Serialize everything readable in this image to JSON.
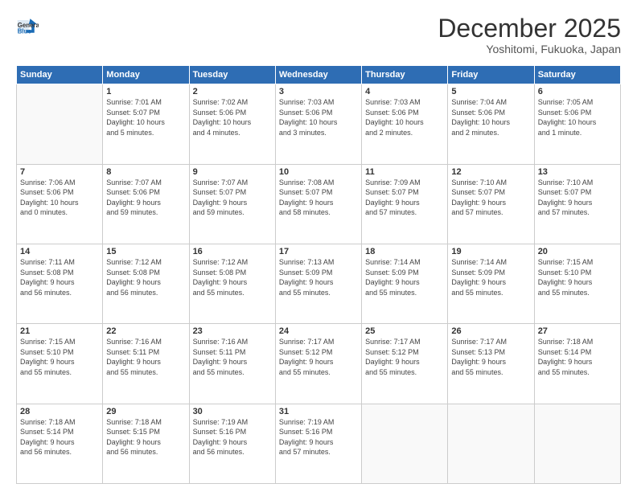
{
  "logo": {
    "line1": "General",
    "line2": "Blue"
  },
  "header": {
    "month": "December 2025",
    "location": "Yoshitomi, Fukuoka, Japan"
  },
  "weekdays": [
    "Sunday",
    "Monday",
    "Tuesday",
    "Wednesday",
    "Thursday",
    "Friday",
    "Saturday"
  ],
  "weeks": [
    [
      {
        "day": "",
        "info": ""
      },
      {
        "day": "1",
        "info": "Sunrise: 7:01 AM\nSunset: 5:07 PM\nDaylight: 10 hours\nand 5 minutes."
      },
      {
        "day": "2",
        "info": "Sunrise: 7:02 AM\nSunset: 5:06 PM\nDaylight: 10 hours\nand 4 minutes."
      },
      {
        "day": "3",
        "info": "Sunrise: 7:03 AM\nSunset: 5:06 PM\nDaylight: 10 hours\nand 3 minutes."
      },
      {
        "day": "4",
        "info": "Sunrise: 7:03 AM\nSunset: 5:06 PM\nDaylight: 10 hours\nand 2 minutes."
      },
      {
        "day": "5",
        "info": "Sunrise: 7:04 AM\nSunset: 5:06 PM\nDaylight: 10 hours\nand 2 minutes."
      },
      {
        "day": "6",
        "info": "Sunrise: 7:05 AM\nSunset: 5:06 PM\nDaylight: 10 hours\nand 1 minute."
      }
    ],
    [
      {
        "day": "7",
        "info": "Sunrise: 7:06 AM\nSunset: 5:06 PM\nDaylight: 10 hours\nand 0 minutes."
      },
      {
        "day": "8",
        "info": "Sunrise: 7:07 AM\nSunset: 5:06 PM\nDaylight: 9 hours\nand 59 minutes."
      },
      {
        "day": "9",
        "info": "Sunrise: 7:07 AM\nSunset: 5:07 PM\nDaylight: 9 hours\nand 59 minutes."
      },
      {
        "day": "10",
        "info": "Sunrise: 7:08 AM\nSunset: 5:07 PM\nDaylight: 9 hours\nand 58 minutes."
      },
      {
        "day": "11",
        "info": "Sunrise: 7:09 AM\nSunset: 5:07 PM\nDaylight: 9 hours\nand 57 minutes."
      },
      {
        "day": "12",
        "info": "Sunrise: 7:10 AM\nSunset: 5:07 PM\nDaylight: 9 hours\nand 57 minutes."
      },
      {
        "day": "13",
        "info": "Sunrise: 7:10 AM\nSunset: 5:07 PM\nDaylight: 9 hours\nand 57 minutes."
      }
    ],
    [
      {
        "day": "14",
        "info": "Sunrise: 7:11 AM\nSunset: 5:08 PM\nDaylight: 9 hours\nand 56 minutes."
      },
      {
        "day": "15",
        "info": "Sunrise: 7:12 AM\nSunset: 5:08 PM\nDaylight: 9 hours\nand 56 minutes."
      },
      {
        "day": "16",
        "info": "Sunrise: 7:12 AM\nSunset: 5:08 PM\nDaylight: 9 hours\nand 55 minutes."
      },
      {
        "day": "17",
        "info": "Sunrise: 7:13 AM\nSunset: 5:09 PM\nDaylight: 9 hours\nand 55 minutes."
      },
      {
        "day": "18",
        "info": "Sunrise: 7:14 AM\nSunset: 5:09 PM\nDaylight: 9 hours\nand 55 minutes."
      },
      {
        "day": "19",
        "info": "Sunrise: 7:14 AM\nSunset: 5:09 PM\nDaylight: 9 hours\nand 55 minutes."
      },
      {
        "day": "20",
        "info": "Sunrise: 7:15 AM\nSunset: 5:10 PM\nDaylight: 9 hours\nand 55 minutes."
      }
    ],
    [
      {
        "day": "21",
        "info": "Sunrise: 7:15 AM\nSunset: 5:10 PM\nDaylight: 9 hours\nand 55 minutes."
      },
      {
        "day": "22",
        "info": "Sunrise: 7:16 AM\nSunset: 5:11 PM\nDaylight: 9 hours\nand 55 minutes."
      },
      {
        "day": "23",
        "info": "Sunrise: 7:16 AM\nSunset: 5:11 PM\nDaylight: 9 hours\nand 55 minutes."
      },
      {
        "day": "24",
        "info": "Sunrise: 7:17 AM\nSunset: 5:12 PM\nDaylight: 9 hours\nand 55 minutes."
      },
      {
        "day": "25",
        "info": "Sunrise: 7:17 AM\nSunset: 5:12 PM\nDaylight: 9 hours\nand 55 minutes."
      },
      {
        "day": "26",
        "info": "Sunrise: 7:17 AM\nSunset: 5:13 PM\nDaylight: 9 hours\nand 55 minutes."
      },
      {
        "day": "27",
        "info": "Sunrise: 7:18 AM\nSunset: 5:14 PM\nDaylight: 9 hours\nand 55 minutes."
      }
    ],
    [
      {
        "day": "28",
        "info": "Sunrise: 7:18 AM\nSunset: 5:14 PM\nDaylight: 9 hours\nand 56 minutes."
      },
      {
        "day": "29",
        "info": "Sunrise: 7:18 AM\nSunset: 5:15 PM\nDaylight: 9 hours\nand 56 minutes."
      },
      {
        "day": "30",
        "info": "Sunrise: 7:19 AM\nSunset: 5:16 PM\nDaylight: 9 hours\nand 56 minutes."
      },
      {
        "day": "31",
        "info": "Sunrise: 7:19 AM\nSunset: 5:16 PM\nDaylight: 9 hours\nand 57 minutes."
      },
      {
        "day": "",
        "info": ""
      },
      {
        "day": "",
        "info": ""
      },
      {
        "day": "",
        "info": ""
      }
    ]
  ]
}
